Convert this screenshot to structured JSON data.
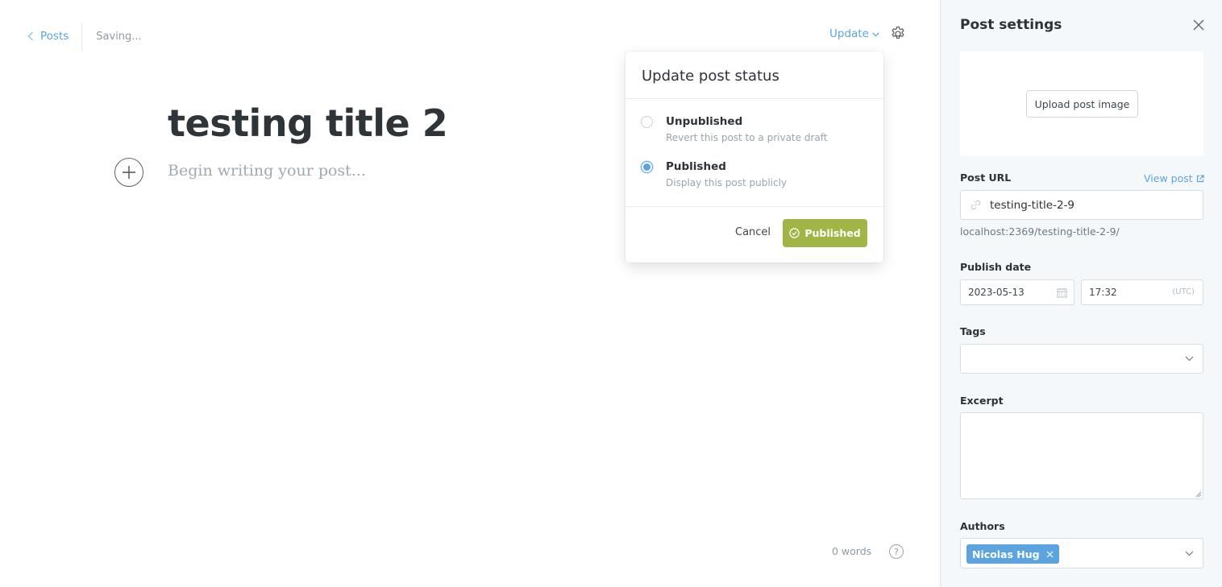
{
  "editor": {
    "back_label": "Posts",
    "save_status": "Saving...",
    "update_label": "Update",
    "post_title": "testing title 2",
    "body_placeholder": "Begin writing your post...",
    "word_count": "0 words",
    "help_glyph": "?"
  },
  "status_popover": {
    "title": "Update post status",
    "options": [
      {
        "label": "Unpublished",
        "description": "Revert this post to a private draft",
        "selected": false
      },
      {
        "label": "Published",
        "description": "Display this post publicly",
        "selected": true
      }
    ],
    "cancel_label": "Cancel",
    "confirm_label": "Published"
  },
  "settings_panel": {
    "title": "Post settings",
    "upload_image_label": "Upload post image",
    "post_url_label": "Post URL",
    "view_post_label": "View post",
    "post_url_value": "testing-title-2-9",
    "post_url_full": "localhost:2369/testing-title-2-9/",
    "publish_date_label": "Publish date",
    "publish_date": "2023-05-13",
    "publish_time": "17:32",
    "timezone": "(UTC)",
    "tags_label": "Tags",
    "excerpt_label": "Excerpt",
    "authors_label": "Authors",
    "authors": [
      "Nicolas Hug"
    ]
  },
  "colors": {
    "accent_blue": "#5ba4e0",
    "publish_green": "#a1b547",
    "panel_bg": "#f4f8fb",
    "title_text": "#2f3438"
  },
  "icons": [
    "chevron-left-icon",
    "chevron-down-icon",
    "gear-icon",
    "plus-icon",
    "help-icon",
    "check-circle-icon",
    "close-icon",
    "link-icon",
    "external-link-icon",
    "calendar-icon",
    "remove-chip-icon"
  ]
}
